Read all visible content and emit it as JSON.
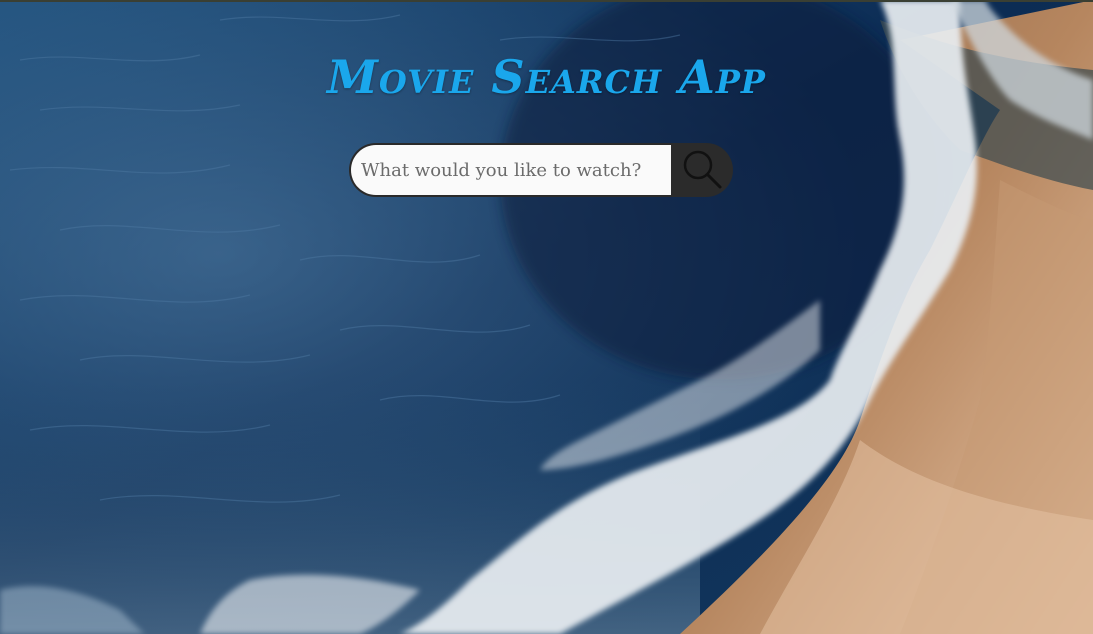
{
  "app": {
    "title": "Movie Search App"
  },
  "search": {
    "placeholder": "What would you like to watch?",
    "value": "",
    "button_icon": "search-icon"
  },
  "colors": {
    "title": "#1aa7ec",
    "search_button_bg": "#2b2b2b",
    "search_input_bg": "#fafafa"
  }
}
